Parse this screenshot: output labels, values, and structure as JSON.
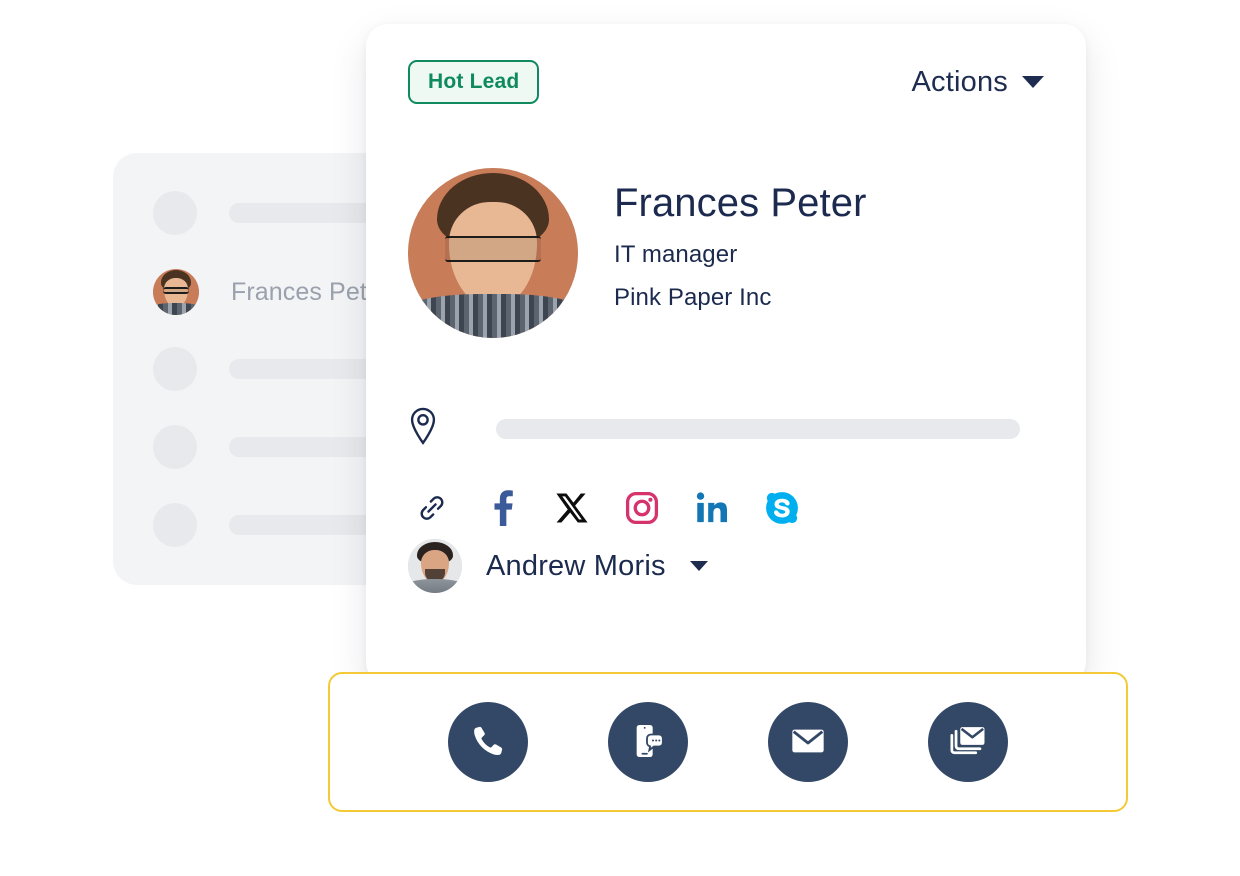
{
  "background_list": {
    "name": "contact-list-panel",
    "rows": [
      {
        "type": "skeleton",
        "label": ""
      },
      {
        "type": "contact",
        "label": "Frances Pet"
      },
      {
        "type": "skeleton",
        "label": ""
      },
      {
        "type": "skeleton",
        "label": ""
      },
      {
        "type": "skeleton",
        "label": ""
      }
    ]
  },
  "card": {
    "badge": {
      "label": "Hot Lead",
      "text_color": "#0f8a5f",
      "border_color": "#0f8a5f",
      "background_color": "#eef9f3"
    },
    "actions": {
      "label": "Actions",
      "icon": "chevron-down-icon"
    },
    "profile": {
      "avatar_alt": "Frances Peter profile photo",
      "name": "Frances Peter",
      "role": "IT manager",
      "company": "Pink Paper Inc"
    },
    "location": {
      "icon": "map-pin-icon",
      "value": ""
    },
    "social_links": [
      {
        "name": "website-link-icon",
        "label": "Website",
        "color": "#1b2a4e"
      },
      {
        "name": "facebook-icon",
        "label": "Facebook",
        "color": "#3b5a9a"
      },
      {
        "name": "x-twitter-icon",
        "label": "X",
        "color": "#0d0d0d"
      },
      {
        "name": "instagram-icon",
        "label": "Instagram",
        "color": "#d6336c"
      },
      {
        "name": "linkedin-icon",
        "label": "LinkedIn",
        "color": "#1477b5"
      },
      {
        "name": "skype-icon",
        "label": "Skype",
        "color": "#00aff0"
      }
    ],
    "assignee": {
      "name": "Andrew Moris",
      "icon": "chevron-down-icon",
      "avatar_alt": "Andrew Moris avatar"
    }
  },
  "action_bar": {
    "border_color": "#f3c937",
    "button_color": "#334866",
    "buttons": [
      {
        "name": "call-button",
        "icon": "phone-icon",
        "label": "Call"
      },
      {
        "name": "sms-button",
        "icon": "sms-chat-icon",
        "label": "SMS"
      },
      {
        "name": "email-button",
        "icon": "envelope-icon",
        "label": "Email"
      },
      {
        "name": "bulk-email-button",
        "icon": "stacked-envelopes-icon",
        "label": "Bulk Email"
      }
    ]
  }
}
